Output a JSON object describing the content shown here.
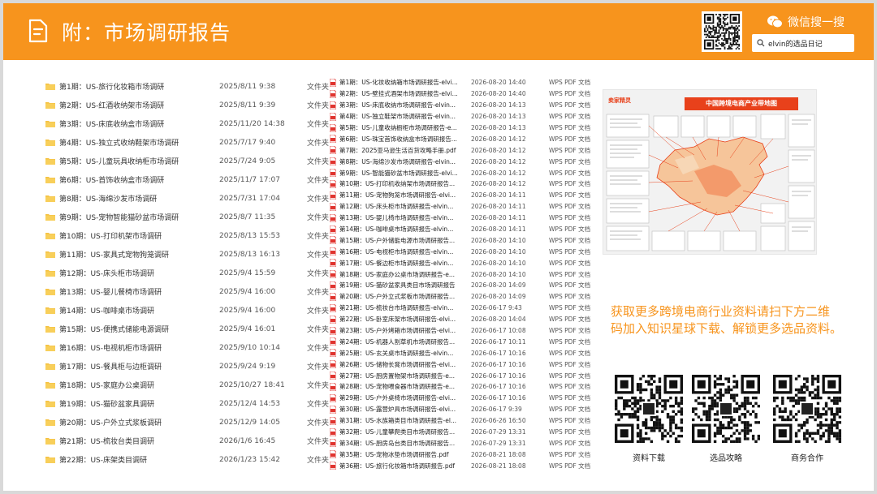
{
  "header": {
    "title": "附：市场调研报告",
    "wechat_label": "微信搜一搜",
    "search_text": "elvin的选品日记"
  },
  "folders": [
    {
      "name": "第1期：US-旅行化妆箱市场调研",
      "date": "2025/8/11 9:38",
      "type": "文件夹"
    },
    {
      "name": "第2期：US-红酒收纳架市场调研",
      "date": "2025/8/11 9:39",
      "type": "文件夹"
    },
    {
      "name": "第3期：US-床底收纳盒市场调研",
      "date": "2025/11/20 14:38",
      "type": "文件夹"
    },
    {
      "name": "第4期：US-独立式收纳鞋架市场调研",
      "date": "2025/7/17 9:40",
      "type": "文件夹"
    },
    {
      "name": "第5期：US-儿童玩具收纳柜市场调研",
      "date": "2025/7/24 9:05",
      "type": "文件夹"
    },
    {
      "name": "第6期：US-首饰收纳盒市场调研",
      "date": "2025/11/7 17:07",
      "type": "文件夹"
    },
    {
      "name": "第8期：US-海绵沙发市场调研",
      "date": "2025/7/31 17:04",
      "type": "文件夹"
    },
    {
      "name": "第9期：US-宠物智能猫砂盆市场调研",
      "date": "2025/8/7 11:35",
      "type": "文件夹"
    },
    {
      "name": "第10期：US-打印机架市场调研",
      "date": "2025/8/13 15:53",
      "type": "文件夹"
    },
    {
      "name": "第11期：US-家具式宠物狗笼调研",
      "date": "2025/8/13 16:13",
      "type": "文件夹"
    },
    {
      "name": "第12期：US-床头柜市场调研",
      "date": "2025/9/4 15:59",
      "type": "文件夹"
    },
    {
      "name": "第13期：US-婴儿餐椅市场调研",
      "date": "2025/9/4 16:00",
      "type": "文件夹"
    },
    {
      "name": "第14期：US-咖啡桌市场调研",
      "date": "2025/9/4 16:00",
      "type": "文件夹"
    },
    {
      "name": "第15期：US-便携式储能电源调研",
      "date": "2025/9/4 16:01",
      "type": "文件夹"
    },
    {
      "name": "第16期：US-电视机柜市场调研",
      "date": "2025/9/10 10:14",
      "type": "文件夹"
    },
    {
      "name": "第17期：US-餐具柜与边柜调研",
      "date": "2025/9/24 9:19",
      "type": "文件夹"
    },
    {
      "name": "第18期：US-家庭办公桌调研",
      "date": "2025/10/27 18:41",
      "type": "文件夹"
    },
    {
      "name": "第19期：US-猫砂盆家具调研",
      "date": "2025/12/4 14:53",
      "type": "文件夹"
    },
    {
      "name": "第20期：US-户外立式浆板调研",
      "date": "2025/12/9 14:05",
      "type": "文件夹"
    },
    {
      "name": "第21期：US-梳妆台类目调研",
      "date": "2026/1/6 16:45",
      "type": "文件夹"
    },
    {
      "name": "第22期：US-床架类目调研",
      "date": "2026/1/23 15:42",
      "type": "文件夹"
    }
  ],
  "pdfs": [
    {
      "name": "第1期：US-化妆收纳箱市场调研报告-elvi...",
      "date": "2026-08-20 14:40",
      "type": "WPS PDF 文档"
    },
    {
      "name": "第2期：US-壁挂式酒架市场调研报告-elvi...",
      "date": "2026-08-20 14:40",
      "type": "WPS PDF 文档"
    },
    {
      "name": "第3期：US-床底收纳市场调研报告-elvin...",
      "date": "2026-08-20 14:13",
      "type": "WPS PDF 文档"
    },
    {
      "name": "第4期：US-独立鞋架市场调研报告-elvin...",
      "date": "2026-08-20 14:13",
      "type": "WPS PDF 文档"
    },
    {
      "name": "第5期：US-儿童收纳橱柜市场调研报告-e...",
      "date": "2026-08-20 14:13",
      "type": "WPS PDF 文档"
    },
    {
      "name": "第6期：US-珠宝首饰收纳盒市场调研报告...",
      "date": "2026-08-20 14:12",
      "type": "WPS PDF 文档"
    },
    {
      "name": "第7期：2025亚马逊生活百货攻略手册.pdf",
      "date": "2026-08-20 14:12",
      "type": "WPS PDF 文档"
    },
    {
      "name": "第8期：US-海绵沙发市场调研报告-elvin...",
      "date": "2026-08-20 14:12",
      "type": "WPS PDF 文档"
    },
    {
      "name": "第9期：US-智能猫砂盆市场调研报告-elvi...",
      "date": "2026-08-20 14:12",
      "type": "WPS PDF 文档"
    },
    {
      "name": "第10期：US-打印机收纳架市场调研报告...",
      "date": "2026-08-20 14:12",
      "type": "WPS PDF 文档"
    },
    {
      "name": "第11期：US-宠物狗笼市场调研报告-elvi...",
      "date": "2026-08-20 14:11",
      "type": "WPS PDF 文档"
    },
    {
      "name": "第12期：US-床头柜市场调研报告-elvin...",
      "date": "2026-08-20 14:11",
      "type": "WPS PDF 文档"
    },
    {
      "name": "第13期：US-婴儿椅市场调研报告-elvin...",
      "date": "2026-08-20 14:11",
      "type": "WPS PDF 文档"
    },
    {
      "name": "第14期：US-咖啡桌市场调研报告-elvin...",
      "date": "2026-08-20 14:11",
      "type": "WPS PDF 文档"
    },
    {
      "name": "第15期：US-户外储能电源市场调研报告...",
      "date": "2026-08-20 14:10",
      "type": "WPS PDF 文档"
    },
    {
      "name": "第16期：US-电视柜市场调研报告-elvin...",
      "date": "2026-08-20 14:10",
      "type": "WPS PDF 文档"
    },
    {
      "name": "第17期：US-餐边柜市场调研报告-elvin...",
      "date": "2026-08-20 14:10",
      "type": "WPS PDF 文档"
    },
    {
      "name": "第18期：US-家庭办公桌市场调研报告-e...",
      "date": "2026-08-20 14:10",
      "type": "WPS PDF 文档"
    },
    {
      "name": "第19期：US-猫砂盆家具类目市场调研报告",
      "date": "2026-08-20 14:09",
      "type": "WPS PDF 文档"
    },
    {
      "name": "第20期：US-户外立式浆板市场调研报告...",
      "date": "2026-08-20 14:09",
      "type": "WPS PDF 文档"
    },
    {
      "name": "第21期：US-梳妆台市场调研报告-elvin...",
      "date": "2026-06-17 9:43",
      "type": "WPS PDF 文档"
    },
    {
      "name": "第22期：US-卧室床架市场调研报告-elvi...",
      "date": "2026-08-20 14:04",
      "type": "WPS PDF 文档"
    },
    {
      "name": "第23期：US-户外烤箱市场调研报告-elvi...",
      "date": "2026-06-17 10:08",
      "type": "WPS PDF 文档"
    },
    {
      "name": "第24期：US-机器人割草机市场调研报告...",
      "date": "2026-06-17 10:11",
      "type": "WPS PDF 文档"
    },
    {
      "name": "第25期：US-玄关桌市场调研报告-elvin...",
      "date": "2026-06-17 10:16",
      "type": "WPS PDF 文档"
    },
    {
      "name": "第26期：US-储物长凳市场调研报告-elvi...",
      "date": "2026-06-17 10:16",
      "type": "WPS PDF 文档"
    },
    {
      "name": "第27期：US-厨房置物架市场调研报告-e...",
      "date": "2026-06-17 10:16",
      "type": "WPS PDF 文档"
    },
    {
      "name": "第28期：US-宠物喂食器市场调研报告-e...",
      "date": "2026-06-17 10:16",
      "type": "WPS PDF 文档"
    },
    {
      "name": "第29期：US-户外桌椅市场调研报告-elvi...",
      "date": "2026-06-17 10:16",
      "type": "WPS PDF 文档"
    },
    {
      "name": "第30期：US-露营炉具市场调研报告-elvi...",
      "date": "2026-06-17 9:39",
      "type": "WPS PDF 文档"
    },
    {
      "name": "第31期：US-水族箱类目市场调研报告-el...",
      "date": "2026-06-26 16:50",
      "type": "WPS PDF 文档"
    },
    {
      "name": "第32期：US-儿童攀爬类目市场调研报告...",
      "date": "2026-07-29 13:31",
      "type": "WPS PDF 文档"
    },
    {
      "name": "第34期：US-厨房岛台类目市场调研报告...",
      "date": "2026-07-29 13:31",
      "type": "WPS PDF 文档"
    },
    {
      "name": "第35期：US-宠物冰垫市场调研报告.pdf",
      "date": "2026-08-21 18:08",
      "type": "WPS PDF 文档"
    },
    {
      "name": "第36期：US-旅行化妆箱市场调研报告.pdf",
      "date": "2026-08-21 18:08",
      "type": "WPS PDF 文档"
    }
  ],
  "map": {
    "brand": "卖家精灵",
    "title": "中国跨境电商产业带地图"
  },
  "promo": {
    "line1": "获取更多跨境电商行业资料请扫下方二维",
    "line2": "码加入知识星球下载、解锁更多选品资料。"
  },
  "qr_codes": [
    {
      "label": "资料下载"
    },
    {
      "label": "选品攻略"
    },
    {
      "label": "商务合作"
    }
  ],
  "colors": {
    "accent": "#f7941d",
    "map_red": "#e8411b",
    "folder": "#f5c242",
    "pdf": "#e0342f"
  }
}
